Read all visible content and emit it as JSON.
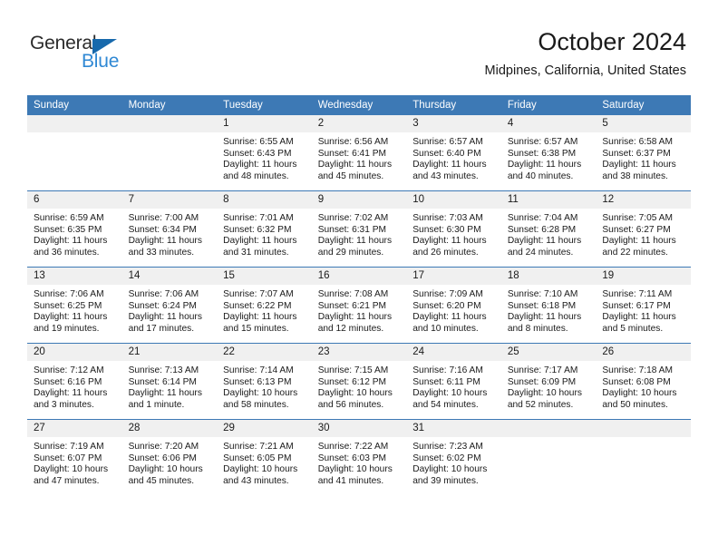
{
  "brand": {
    "name_part1": "General",
    "name_part2": "Blue",
    "triangle_color": "#1769ac",
    "blue_color": "#2f88d4"
  },
  "header": {
    "title": "October 2024",
    "subtitle": "Midpines, California, United States"
  },
  "theme": {
    "header_blue": "#3d79b5",
    "daynum_band": "#f0f0f0",
    "row_separator": "#3d79b5"
  },
  "weekday_headers": [
    "Sunday",
    "Monday",
    "Tuesday",
    "Wednesday",
    "Thursday",
    "Friday",
    "Saturday"
  ],
  "weeks": [
    [
      {
        "day": "",
        "sunrise": "",
        "sunset": "",
        "daylight": "",
        "empty": true
      },
      {
        "day": "",
        "sunrise": "",
        "sunset": "",
        "daylight": "",
        "empty": true
      },
      {
        "day": "1",
        "sunrise": "Sunrise: 6:55 AM",
        "sunset": "Sunset: 6:43 PM",
        "daylight": "Daylight: 11 hours and 48 minutes."
      },
      {
        "day": "2",
        "sunrise": "Sunrise: 6:56 AM",
        "sunset": "Sunset: 6:41 PM",
        "daylight": "Daylight: 11 hours and 45 minutes."
      },
      {
        "day": "3",
        "sunrise": "Sunrise: 6:57 AM",
        "sunset": "Sunset: 6:40 PM",
        "daylight": "Daylight: 11 hours and 43 minutes."
      },
      {
        "day": "4",
        "sunrise": "Sunrise: 6:57 AM",
        "sunset": "Sunset: 6:38 PM",
        "daylight": "Daylight: 11 hours and 40 minutes."
      },
      {
        "day": "5",
        "sunrise": "Sunrise: 6:58 AM",
        "sunset": "Sunset: 6:37 PM",
        "daylight": "Daylight: 11 hours and 38 minutes."
      }
    ],
    [
      {
        "day": "6",
        "sunrise": "Sunrise: 6:59 AM",
        "sunset": "Sunset: 6:35 PM",
        "daylight": "Daylight: 11 hours and 36 minutes."
      },
      {
        "day": "7",
        "sunrise": "Sunrise: 7:00 AM",
        "sunset": "Sunset: 6:34 PM",
        "daylight": "Daylight: 11 hours and 33 minutes."
      },
      {
        "day": "8",
        "sunrise": "Sunrise: 7:01 AM",
        "sunset": "Sunset: 6:32 PM",
        "daylight": "Daylight: 11 hours and 31 minutes."
      },
      {
        "day": "9",
        "sunrise": "Sunrise: 7:02 AM",
        "sunset": "Sunset: 6:31 PM",
        "daylight": "Daylight: 11 hours and 29 minutes."
      },
      {
        "day": "10",
        "sunrise": "Sunrise: 7:03 AM",
        "sunset": "Sunset: 6:30 PM",
        "daylight": "Daylight: 11 hours and 26 minutes."
      },
      {
        "day": "11",
        "sunrise": "Sunrise: 7:04 AM",
        "sunset": "Sunset: 6:28 PM",
        "daylight": "Daylight: 11 hours and 24 minutes."
      },
      {
        "day": "12",
        "sunrise": "Sunrise: 7:05 AM",
        "sunset": "Sunset: 6:27 PM",
        "daylight": "Daylight: 11 hours and 22 minutes."
      }
    ],
    [
      {
        "day": "13",
        "sunrise": "Sunrise: 7:06 AM",
        "sunset": "Sunset: 6:25 PM",
        "daylight": "Daylight: 11 hours and 19 minutes."
      },
      {
        "day": "14",
        "sunrise": "Sunrise: 7:06 AM",
        "sunset": "Sunset: 6:24 PM",
        "daylight": "Daylight: 11 hours and 17 minutes."
      },
      {
        "day": "15",
        "sunrise": "Sunrise: 7:07 AM",
        "sunset": "Sunset: 6:22 PM",
        "daylight": "Daylight: 11 hours and 15 minutes."
      },
      {
        "day": "16",
        "sunrise": "Sunrise: 7:08 AM",
        "sunset": "Sunset: 6:21 PM",
        "daylight": "Daylight: 11 hours and 12 minutes."
      },
      {
        "day": "17",
        "sunrise": "Sunrise: 7:09 AM",
        "sunset": "Sunset: 6:20 PM",
        "daylight": "Daylight: 11 hours and 10 minutes."
      },
      {
        "day": "18",
        "sunrise": "Sunrise: 7:10 AM",
        "sunset": "Sunset: 6:18 PM",
        "daylight": "Daylight: 11 hours and 8 minutes."
      },
      {
        "day": "19",
        "sunrise": "Sunrise: 7:11 AM",
        "sunset": "Sunset: 6:17 PM",
        "daylight": "Daylight: 11 hours and 5 minutes."
      }
    ],
    [
      {
        "day": "20",
        "sunrise": "Sunrise: 7:12 AM",
        "sunset": "Sunset: 6:16 PM",
        "daylight": "Daylight: 11 hours and 3 minutes."
      },
      {
        "day": "21",
        "sunrise": "Sunrise: 7:13 AM",
        "sunset": "Sunset: 6:14 PM",
        "daylight": "Daylight: 11 hours and 1 minute."
      },
      {
        "day": "22",
        "sunrise": "Sunrise: 7:14 AM",
        "sunset": "Sunset: 6:13 PM",
        "daylight": "Daylight: 10 hours and 58 minutes."
      },
      {
        "day": "23",
        "sunrise": "Sunrise: 7:15 AM",
        "sunset": "Sunset: 6:12 PM",
        "daylight": "Daylight: 10 hours and 56 minutes."
      },
      {
        "day": "24",
        "sunrise": "Sunrise: 7:16 AM",
        "sunset": "Sunset: 6:11 PM",
        "daylight": "Daylight: 10 hours and 54 minutes."
      },
      {
        "day": "25",
        "sunrise": "Sunrise: 7:17 AM",
        "sunset": "Sunset: 6:09 PM",
        "daylight": "Daylight: 10 hours and 52 minutes."
      },
      {
        "day": "26",
        "sunrise": "Sunrise: 7:18 AM",
        "sunset": "Sunset: 6:08 PM",
        "daylight": "Daylight: 10 hours and 50 minutes."
      }
    ],
    [
      {
        "day": "27",
        "sunrise": "Sunrise: 7:19 AM",
        "sunset": "Sunset: 6:07 PM",
        "daylight": "Daylight: 10 hours and 47 minutes."
      },
      {
        "day": "28",
        "sunrise": "Sunrise: 7:20 AM",
        "sunset": "Sunset: 6:06 PM",
        "daylight": "Daylight: 10 hours and 45 minutes."
      },
      {
        "day": "29",
        "sunrise": "Sunrise: 7:21 AM",
        "sunset": "Sunset: 6:05 PM",
        "daylight": "Daylight: 10 hours and 43 minutes."
      },
      {
        "day": "30",
        "sunrise": "Sunrise: 7:22 AM",
        "sunset": "Sunset: 6:03 PM",
        "daylight": "Daylight: 10 hours and 41 minutes."
      },
      {
        "day": "31",
        "sunrise": "Sunrise: 7:23 AM",
        "sunset": "Sunset: 6:02 PM",
        "daylight": "Daylight: 10 hours and 39 minutes."
      },
      {
        "day": "",
        "sunrise": "",
        "sunset": "",
        "daylight": "",
        "empty": true
      },
      {
        "day": "",
        "sunrise": "",
        "sunset": "",
        "daylight": "",
        "empty": true
      }
    ]
  ]
}
